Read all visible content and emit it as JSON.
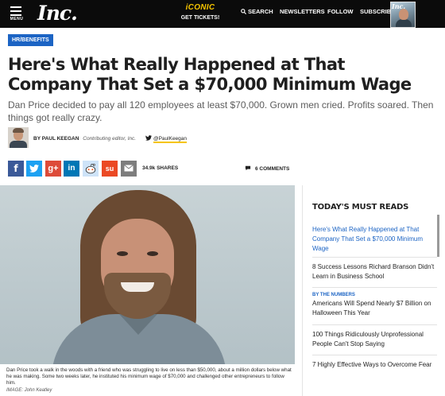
{
  "nav": {
    "menu_label": "MENU",
    "logo": "Inc.",
    "promo_title": "iCONIC",
    "promo_sub": "GET TICKETS!",
    "search": "SEARCH",
    "newsletters": "NEWSLETTERS",
    "follow": "FOLLOW",
    "subscribe": "SUBSCRIBE",
    "magazine_cover_title": "Inc."
  },
  "article": {
    "tag": "HR/BENEFITS",
    "headline": "Here's What Really Happened at That Company That Set a $70,000 Minimum Wage",
    "dek": "Dan Price decided to pay all 120 employees at least $70,000. Grown men cried. Profits soared. Then things got really crazy.",
    "byline_name": "BY PAUL KEEGAN",
    "byline_title": "Contributing editor, Inc.",
    "twitter_handle": "@PaulKeegan"
  },
  "share": {
    "facebook": "f",
    "twitter": "t",
    "googleplus": "g+",
    "linkedin": "in",
    "stumbleupon": "su",
    "count": "34.9k SHARES",
    "comments": "6 COMMENTS"
  },
  "image": {
    "caption": "Dan Price took a walk in the woods with a friend who was struggling to live on less than $50,000, about a million dollars below what he was making. Some two weeks later, he instituted his minimum wage of $70,000 and challenged other entrepreneurs to follow him.",
    "credit": "IMAGE: John Keatley"
  },
  "sidebar": {
    "title": "TODAY'S MUST READS",
    "items": [
      {
        "kicker": "",
        "title": "Here's What Really Happened at That Company That Set a $70,000 Minimum Wage"
      },
      {
        "kicker": "",
        "title": "8 Success Lessons Richard Branson Didn't Learn in Business School"
      },
      {
        "kicker": "BY THE NUMBERS",
        "title": "Americans Will Spend Nearly $7 Billion on Halloween This Year"
      },
      {
        "kicker": "",
        "title": "100 Things Ridiculously Unprofessional People Can't Stop Saying"
      },
      {
        "kicker": "",
        "title": "7 Highly Effective Ways to Overcome Fear"
      }
    ]
  },
  "colors": {
    "accent_blue": "#1c64c4",
    "promo_yellow": "#f5c400",
    "topbar": "#0b0b0b",
    "facebook": "#3b5998",
    "twitter": "#1da1f2",
    "googleplus": "#dd4b39",
    "linkedin": "#0077b5",
    "stumbleupon": "#eb4924"
  }
}
